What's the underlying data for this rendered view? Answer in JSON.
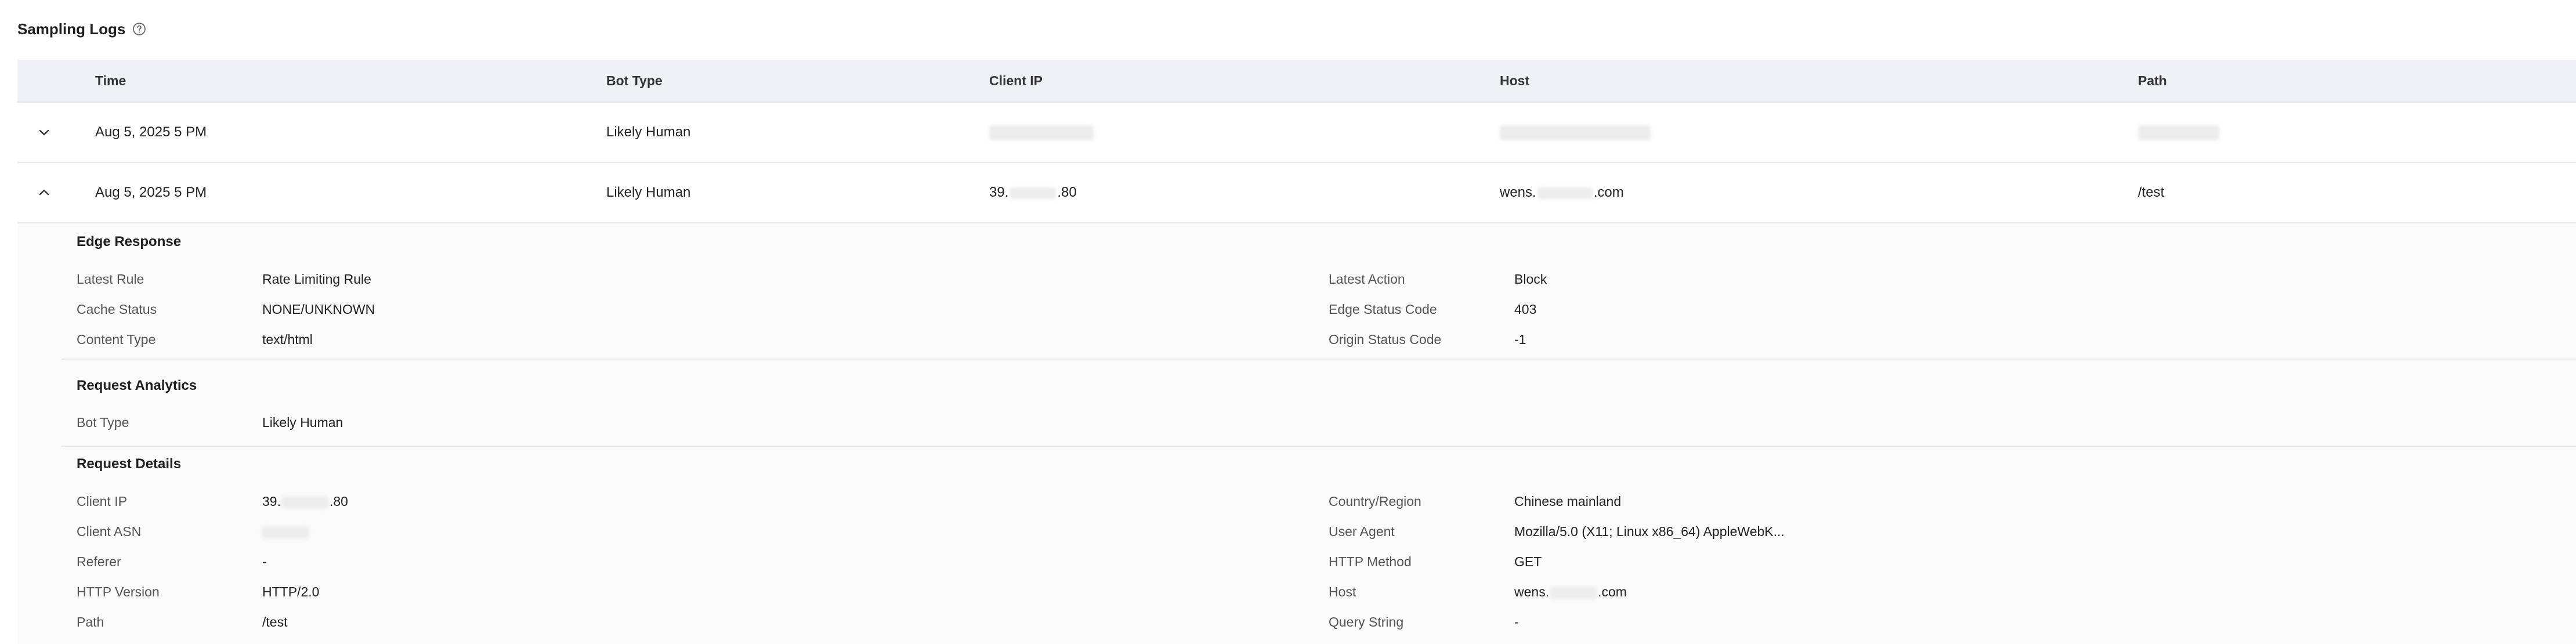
{
  "page": {
    "title": "Sampling Logs",
    "help_icon": "help-circle-icon"
  },
  "table": {
    "columns": [
      "Time",
      "Bot Type",
      "Client IP",
      "Host",
      "Path"
    ],
    "rows": [
      {
        "time": "Aug 5, 2025 5 PM",
        "bot_type": "Likely Human",
        "expanded": false,
        "chevron_icon": "chevron-down-icon"
      },
      {
        "time": "Aug 5, 2025 5 PM",
        "bot_type": "Likely Human",
        "client_ip_prefix": "39.",
        "client_ip_suffix": ".80",
        "host_prefix": "wens.",
        "host_suffix": ".com",
        "path": "/test",
        "expanded": true,
        "chevron_icon": "chevron-up-icon"
      }
    ]
  },
  "detail": {
    "edge_response": {
      "title": "Edge Response",
      "left": [
        {
          "label": "Latest Rule",
          "value": "Rate Limiting Rule"
        },
        {
          "label": "Cache Status",
          "value": "NONE/UNKNOWN"
        },
        {
          "label": "Content Type",
          "value": "text/html"
        }
      ],
      "right": [
        {
          "label": "Latest Action",
          "value": "Block"
        },
        {
          "label": "Edge Status Code",
          "value": "403"
        },
        {
          "label": "Origin Status Code",
          "value": "-1"
        }
      ]
    },
    "request_analytics": {
      "title": "Request Analytics",
      "left": [
        {
          "label": "Bot Type",
          "value": "Likely Human"
        }
      ]
    },
    "request_details": {
      "title": "Request Details",
      "left": [
        {
          "label": "Client IP",
          "value_prefix": "39.",
          "value_suffix": ".80"
        },
        {
          "label": "Client ASN"
        },
        {
          "label": "Referer",
          "value": "-"
        },
        {
          "label": "HTTP Version",
          "value": "HTTP/2.0"
        },
        {
          "label": "Path",
          "value": "/test"
        }
      ],
      "right": [
        {
          "label": "Country/Region",
          "value": "Chinese mainland"
        },
        {
          "label": "User Agent",
          "value": "Mozilla/5.0 (X11; Linux x86_64) AppleWebK..."
        },
        {
          "label": "HTTP Method",
          "value": "GET"
        },
        {
          "label": "Host",
          "value_prefix": "wens.",
          "value_suffix": ".com"
        },
        {
          "label": "Query String",
          "value": "-"
        }
      ]
    }
  }
}
